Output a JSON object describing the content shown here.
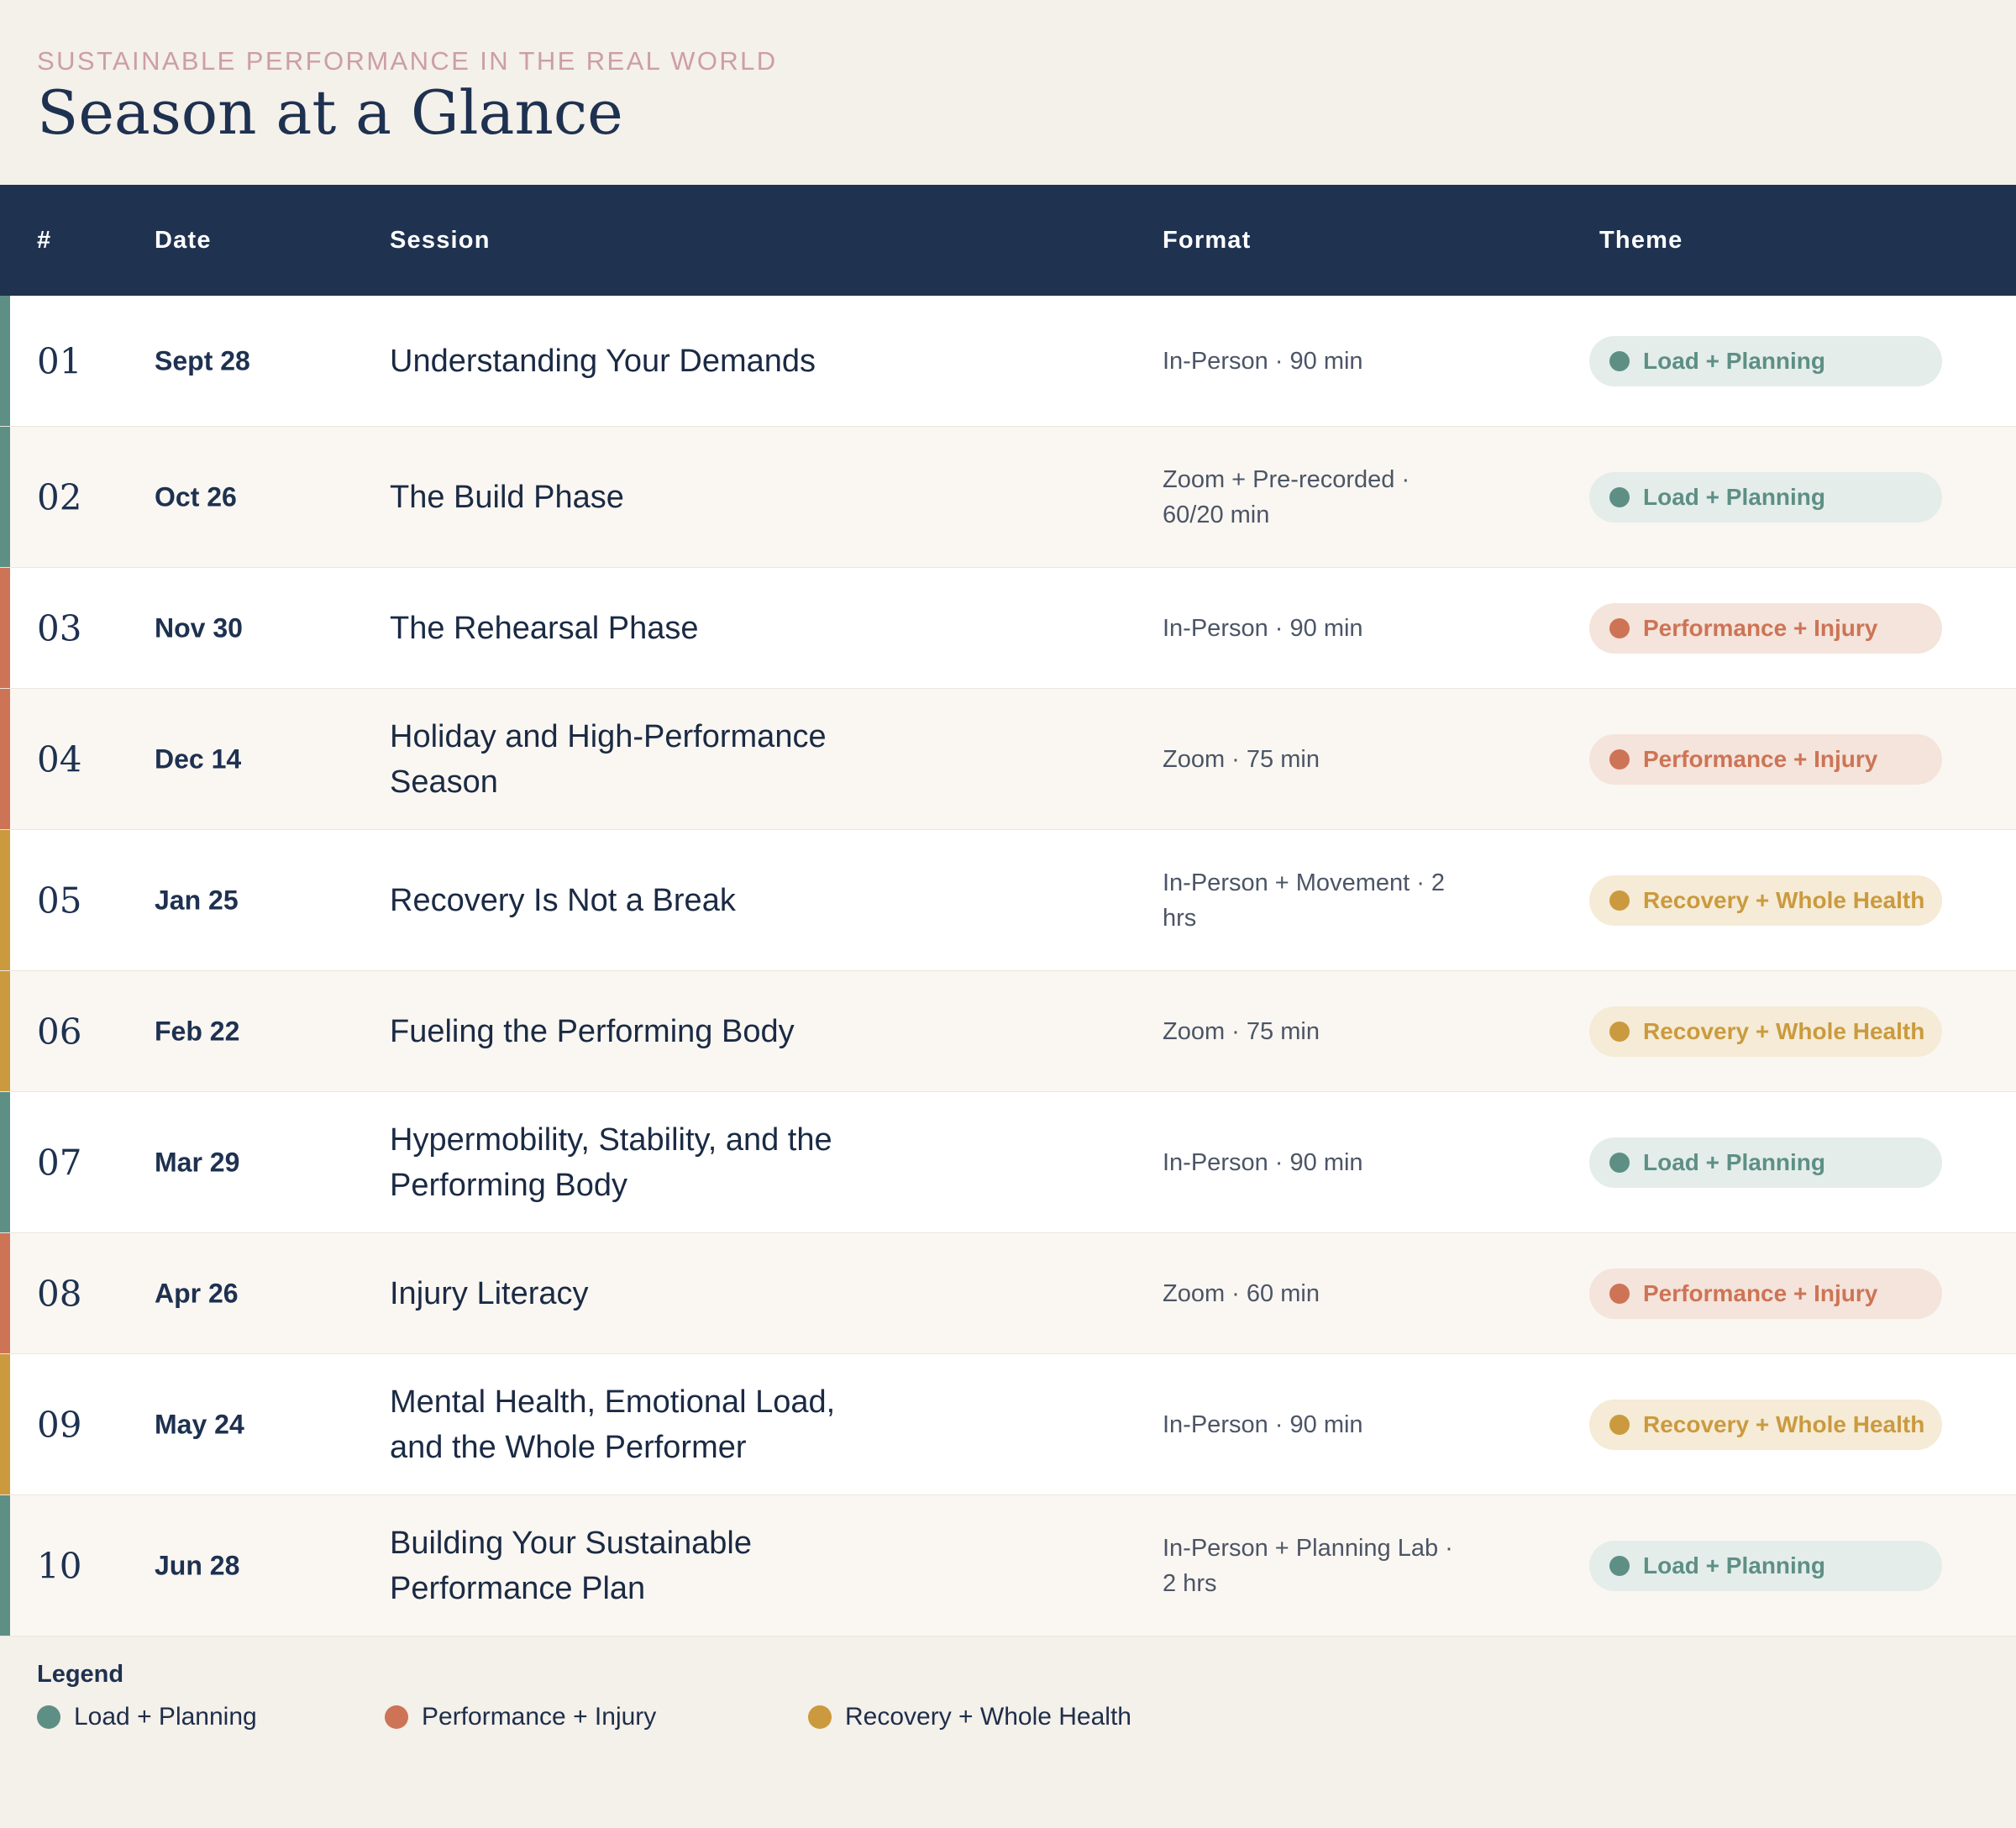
{
  "header": {
    "eyebrow": "SUSTAINABLE PERFORMANCE IN THE REAL WORLD",
    "title": "Season at a Glance"
  },
  "table": {
    "columns": [
      "#",
      "Date",
      "Session",
      "Format",
      "Theme"
    ],
    "rows": [
      {
        "num": "01",
        "date": "Sept 28",
        "session": "Understanding Your Demands",
        "format": "In-Person · 90 min",
        "theme": "Load + Planning",
        "theme_key": "load"
      },
      {
        "num": "02",
        "date": "Oct 26",
        "session": "The Build Phase",
        "format": "Zoom + Pre-recorded · 60/20 min",
        "theme": "Load + Planning",
        "theme_key": "load"
      },
      {
        "num": "03",
        "date": "Nov 30",
        "session": "The Rehearsal Phase",
        "format": "In-Person · 90 min",
        "theme": "Performance + Injury",
        "theme_key": "perf"
      },
      {
        "num": "04",
        "date": "Dec 14",
        "session": "Holiday and High-Performance Season",
        "format": "Zoom · 75 min",
        "theme": "Performance + Injury",
        "theme_key": "perf"
      },
      {
        "num": "05",
        "date": "Jan 25",
        "session": "Recovery Is Not a Break",
        "format": "In-Person + Movement · 2 hrs",
        "theme": "Recovery + Whole Health",
        "theme_key": "rec"
      },
      {
        "num": "06",
        "date": "Feb 22",
        "session": "Fueling the Performing Body",
        "format": "Zoom · 75 min",
        "theme": "Recovery + Whole Health",
        "theme_key": "rec"
      },
      {
        "num": "07",
        "date": "Mar 29",
        "session": "Hypermobility, Stability, and the Performing Body",
        "format": "In-Person · 90 min",
        "theme": "Load + Planning",
        "theme_key": "load"
      },
      {
        "num": "08",
        "date": "Apr 26",
        "session": "Injury Literacy",
        "format": "Zoom · 60 min",
        "theme": "Performance + Injury",
        "theme_key": "perf"
      },
      {
        "num": "09",
        "date": "May 24",
        "session": "Mental Health, Emotional Load, and the Whole Performer",
        "format": "In-Person · 90 min",
        "theme": "Recovery + Whole Health",
        "theme_key": "rec"
      },
      {
        "num": "10",
        "date": "Jun 28",
        "session": "Building Your Sustainable Performance Plan",
        "format": "In-Person + Planning Lab · 2 hrs",
        "theme": "Load + Planning",
        "theme_key": "load"
      }
    ]
  },
  "themes": {
    "load": {
      "color": "#5e8f85",
      "pill_bg": "#e4edea"
    },
    "perf": {
      "color": "#cd7456",
      "pill_bg": "#f4e4db"
    },
    "rec": {
      "color": "#cb9a3e",
      "pill_bg": "#f5ebd6"
    }
  },
  "legend": {
    "title": "Legend",
    "items": [
      {
        "label": "Load + Planning",
        "theme_key": "load"
      },
      {
        "label": "Performance + Injury",
        "theme_key": "perf"
      },
      {
        "label": "Recovery + Whole Health",
        "theme_key": "rec"
      }
    ]
  }
}
